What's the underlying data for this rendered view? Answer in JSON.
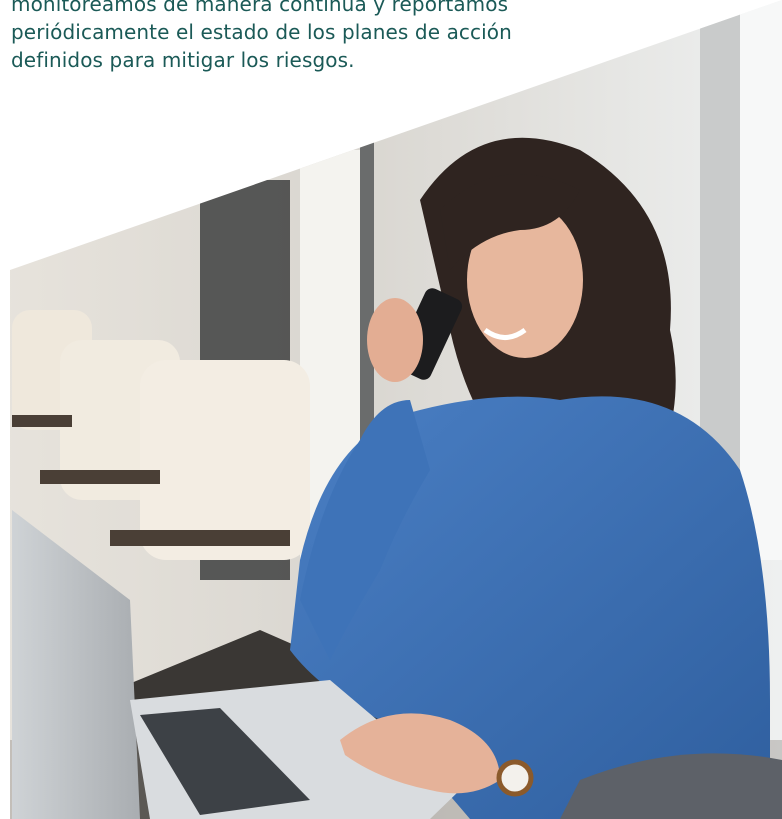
{
  "intro_text": {
    "lines": [
      "monitoreamos de manera continua y reportamos",
      "periódicamente el estado de los planes de acción",
      "definidos para mitigar los riesgos."
    ]
  },
  "colors": {
    "text": "#1b5a57",
    "sweater": "#3b6fb6"
  }
}
